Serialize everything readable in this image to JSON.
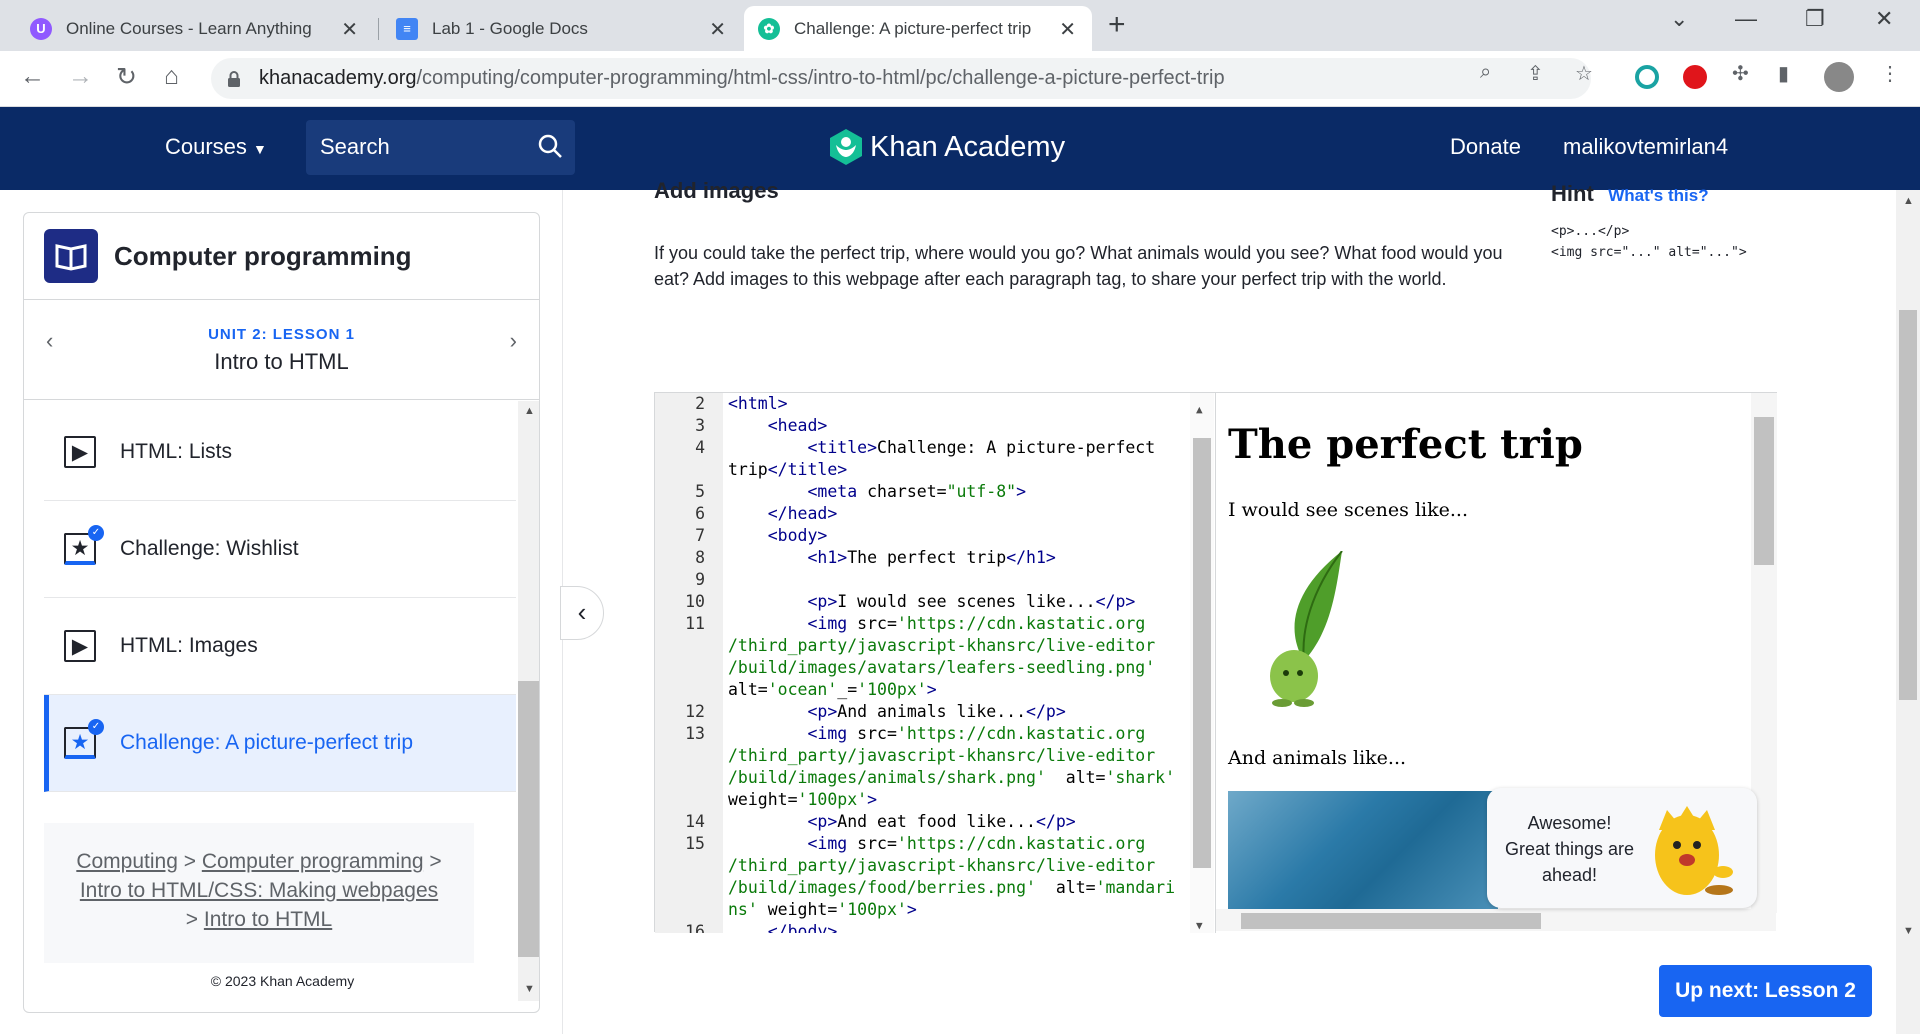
{
  "browser": {
    "tabs": [
      {
        "title": "Online Courses - Learn Anything"
      },
      {
        "title": "Lab 1 - Google Docs"
      },
      {
        "title": "Challenge: A picture-perfect trip"
      }
    ],
    "url_host": "khanacademy.org",
    "url_path": "/computing/computer-programming/html-css/intro-to-html/pc/challenge-a-picture-perfect-trip"
  },
  "nav": {
    "courses": "Courses",
    "search": "Search",
    "logo": "Khan Academy",
    "donate": "Donate",
    "user": "malikovtemirlan4"
  },
  "sidebar": {
    "title": "Computer programming",
    "unit_label": "UNIT 2: LESSON 1",
    "unit_name": "Intro to HTML",
    "items": [
      {
        "label": "HTML: Lists",
        "type": "video"
      },
      {
        "label": "Challenge: Wishlist",
        "type": "challenge"
      },
      {
        "label": "HTML: Images",
        "type": "video"
      },
      {
        "label": "Challenge: A picture-perfect trip",
        "type": "challenge"
      }
    ],
    "crumbs": [
      "Computing",
      "Computer programming",
      "Intro to HTML/CSS: Making webpages",
      "Intro to HTML"
    ],
    "copyright": "© 2023 Khan Academy"
  },
  "content": {
    "section_title": "Add images",
    "description": "If you could take the perfect trip, where would you go? What animals would you see? What food would you eat? Add images to this webpage after each paragraph tag, to share your perfect trip with the world.",
    "hint_title": "Hint",
    "hint_link": "What's this?",
    "hint_code": "<p>...</p>\n<img src=\"...\" alt=\"...\">"
  },
  "editor": {
    "line_numbers": [
      "2",
      "3",
      "4",
      "",
      "5",
      "6",
      "7",
      "8",
      "9",
      "10",
      "11",
      "",
      "",
      "",
      "12",
      "13",
      "",
      "",
      "",
      "14",
      "15",
      "",
      "",
      "",
      "16"
    ]
  },
  "preview": {
    "h1": "The perfect trip",
    "p1": "I would see scenes like...",
    "p2": "And animals like..."
  },
  "bubble": {
    "line1": "Awesome!",
    "line2": "Great things are",
    "line3": "ahead!"
  },
  "upnext": "Up next: Lesson 2",
  "colors": {
    "navy": "#0a2a66",
    "blue": "#1865f2",
    "green": "#14bf96"
  }
}
